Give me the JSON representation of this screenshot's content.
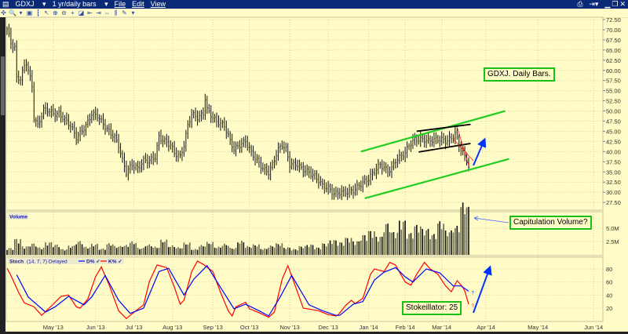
{
  "window": {
    "symbol": "GDXJ",
    "period": "1 yr/daily bars",
    "menu": [
      "File",
      "Edit",
      "View"
    ],
    "controls": [
      "minimize",
      "restore",
      "close"
    ]
  },
  "toolbar_icons": [
    "crosshair-icon",
    "zoom-icon",
    "dropdown-icon",
    "chart-type-icon",
    "bars-icon",
    "draw-line-icon",
    "zoom-in-icon",
    "zoom-out-icon",
    "cross-icon",
    "chart-icon",
    "scroll-left-icon",
    "scroll-right-icon",
    "fit-icon",
    "split-icon",
    "tools-icon",
    "dropdown-icon"
  ],
  "panels": {
    "volume_label": "Volume",
    "stoch_label": "Stoch",
    "stoch_params": "(14, 7, 7) Delayed",
    "stoch_legend": [
      {
        "label": "D%",
        "color": "#0000ff"
      },
      {
        "label": "K%",
        "color": "#ff0000"
      }
    ]
  },
  "annotations": {
    "title": "GDXJ. Daily Bars.",
    "volume": "Capitulation Volume?",
    "stoch": "Stokeillator: 25"
  },
  "colors": {
    "background": "#fffcc8",
    "bars": "#5a5a48",
    "channel": "#22cc22",
    "arrow": "#0033ff",
    "k": "#ff0000",
    "d": "#0000ff"
  },
  "chart_data": [
    {
      "type": "bar",
      "title": "GDXJ daily bars (price)",
      "x_unit": "trading day index",
      "x_labels": [
        {
          "day": 24,
          "label": "May '13"
        },
        {
          "day": 46,
          "label": "Jun '13"
        },
        {
          "day": 66,
          "label": "Jul '13"
        },
        {
          "day": 86,
          "label": "Aug '13"
        },
        {
          "day": 107,
          "label": "Sep '13"
        },
        {
          "day": 126,
          "label": "Oct '13"
        },
        {
          "day": 147,
          "label": "Nov '13"
        },
        {
          "day": 167,
          "label": "Dec '13"
        },
        {
          "day": 188,
          "label": "Jan '14"
        },
        {
          "day": 207,
          "label": "Feb '14"
        },
        {
          "day": 226,
          "label": "Mar '14"
        },
        {
          "day": 249,
          "label": "Apr '14"
        },
        {
          "day": 276,
          "label": "May '14"
        },
        {
          "day": 305,
          "label": "Jun '14"
        }
      ],
      "x_range": [
        0,
        310
      ],
      "ylim": [
        25,
        75
      ],
      "y_ticks": [
        "72.50",
        "70.00",
        "67.50",
        "65.00",
        "62.50",
        "60.00",
        "57.50",
        "55.00",
        "52.50",
        "50.00",
        "47.50",
        "45.00",
        "42.50",
        "40.00",
        "37.50",
        "35.00",
        "32.50",
        "30.00",
        "27.50"
      ],
      "closes": [
        [
          0,
          70.2
        ],
        [
          2,
          66.7
        ],
        [
          4,
          65.7
        ],
        [
          5,
          58
        ],
        [
          7,
          58
        ],
        [
          9,
          61
        ],
        [
          10,
          62
        ],
        [
          13,
          56
        ],
        [
          14,
          48.4
        ],
        [
          16,
          46.4
        ],
        [
          19,
          50.3
        ],
        [
          21,
          50.3
        ],
        [
          24,
          49.3
        ],
        [
          27,
          49.3
        ],
        [
          29,
          48.4
        ],
        [
          33,
          46.4
        ],
        [
          36,
          43.5
        ],
        [
          38,
          44.5
        ],
        [
          41,
          46.4
        ],
        [
          44,
          49.3
        ],
        [
          47,
          48.8
        ],
        [
          49,
          47.4
        ],
        [
          52,
          45.5
        ],
        [
          56,
          43.5
        ],
        [
          58,
          41.6
        ],
        [
          60,
          37.8
        ],
        [
          62,
          34.9
        ],
        [
          65,
          36.8
        ],
        [
          68,
          35.8
        ],
        [
          71,
          37.8
        ],
        [
          74,
          37.8
        ],
        [
          77,
          38.7
        ],
        [
          79,
          43.5
        ],
        [
          82,
          42.6
        ],
        [
          85,
          41.6
        ],
        [
          87,
          39.7
        ],
        [
          90,
          38.7
        ],
        [
          92,
          41.6
        ],
        [
          94,
          46.4
        ],
        [
          96,
          49.3
        ],
        [
          99,
          48.4
        ],
        [
          102,
          49.3
        ],
        [
          103,
          53.2
        ],
        [
          104,
          50.3
        ],
        [
          107,
          48.4
        ],
        [
          109,
          47.4
        ],
        [
          113,
          46.4
        ],
        [
          116,
          42.6
        ],
        [
          118,
          40.6
        ],
        [
          121,
          41.6
        ],
        [
          124,
          42.6
        ],
        [
          127,
          39.7
        ],
        [
          130,
          37.8
        ],
        [
          133,
          35.8
        ],
        [
          136,
          34.9
        ],
        [
          138,
          36.8
        ],
        [
          141,
          40.6
        ],
        [
          143,
          41.6
        ],
        [
          145,
          40.6
        ],
        [
          147,
          36.8
        ],
        [
          151,
          36.8
        ],
        [
          153,
          35.8
        ],
        [
          157,
          34.9
        ],
        [
          160,
          33.9
        ],
        [
          162,
          32.9
        ],
        [
          164,
          31.6
        ],
        [
          167,
          31
        ],
        [
          170,
          29.6
        ],
        [
          174,
          30
        ],
        [
          177,
          30
        ],
        [
          180,
          30.4
        ],
        [
          184,
          32
        ],
        [
          188,
          33.3
        ],
        [
          191,
          35.2
        ],
        [
          194,
          36.8
        ],
        [
          198,
          35.2
        ],
        [
          200,
          35.8
        ],
        [
          202,
          37.8
        ],
        [
          207,
          39.7
        ],
        [
          209,
          41.6
        ],
        [
          212,
          43
        ],
        [
          216,
          43
        ],
        [
          219,
          42.6
        ],
        [
          222,
          43
        ],
        [
          226,
          43
        ],
        [
          228,
          42.6
        ],
        [
          231,
          43.2
        ],
        [
          233,
          44.5
        ],
        [
          235,
          41.6
        ],
        [
          237,
          39.7
        ],
        [
          239,
          37.8
        ],
        [
          240,
          36.8
        ]
      ],
      "annotation_lines": {
        "upper_channel": [
          [
            184,
            40
          ],
          [
            259,
            50
          ]
        ],
        "lower_channel": [
          [
            186,
            28.5
          ],
          [
            261,
            38.2
          ]
        ],
        "flag_top": [
          [
            213,
            45
          ],
          [
            241,
            46.7
          ]
        ],
        "flag_bottom": [
          [
            214,
            39.9
          ],
          [
            241,
            42
          ]
        ]
      }
    },
    {
      "type": "bar",
      "title": "Volume",
      "y_ticks": [
        "5.0M",
        "2.5M"
      ],
      "ylim": [
        0,
        9.5
      ],
      "unit": "millions (sampled every 4 days)",
      "values": [
        1.2,
        2.8,
        1.5,
        2.0,
        1.3,
        2.2,
        1.8,
        1.0,
        1.6,
        2.4,
        1.4,
        1.9,
        1.1,
        2.0,
        1.5,
        1.7,
        2.3,
        1.2,
        1.8,
        1.4,
        2.6,
        1.6,
        1.3,
        2.1,
        1.0,
        1.7,
        2.2,
        1.4,
        1.9,
        1.2,
        2.4,
        1.5,
        1.8,
        1.1,
        1.6,
        2.0,
        1.3,
        1.0,
        1.5,
        1.8,
        1.3,
        2.0,
        2.6,
        2.2,
        3.0,
        2.4,
        3.5,
        4.2,
        3.2,
        5.5,
        4.0,
        6.0,
        3.8,
        5.2,
        4.5,
        3.6,
        5.8,
        4.2,
        5.0,
        9.0
      ]
    },
    {
      "type": "line",
      "title": "Stoch (14, 7, 7)",
      "y_ticks": [
        "80",
        "60",
        "40",
        "20"
      ],
      "ylim": [
        0,
        100
      ],
      "series": [
        {
          "name": "K%",
          "color": "#ff0000",
          "points": [
            [
              0,
              81
            ],
            [
              2,
              70
            ],
            [
              6,
              44
            ],
            [
              9,
              28
            ],
            [
              14,
              22
            ],
            [
              18,
              9
            ],
            [
              24,
              26
            ],
            [
              28,
              38
            ],
            [
              32,
              40
            ],
            [
              36,
              22
            ],
            [
              38,
              20
            ],
            [
              42,
              34
            ],
            [
              46,
              68
            ],
            [
              49,
              83
            ],
            [
              53,
              56
            ],
            [
              58,
              16
            ],
            [
              62,
              4
            ],
            [
              67,
              16
            ],
            [
              71,
              25
            ],
            [
              74,
              61
            ],
            [
              78,
              86
            ],
            [
              83,
              82
            ],
            [
              87,
              52
            ],
            [
              90,
              26
            ],
            [
              92,
              32
            ],
            [
              96,
              76
            ],
            [
              99,
              92
            ],
            [
              102,
              87
            ],
            [
              107,
              76
            ],
            [
              111,
              44
            ],
            [
              115,
              16
            ],
            [
              117,
              8
            ],
            [
              119,
              22
            ],
            [
              124,
              29
            ],
            [
              126,
              19
            ],
            [
              131,
              13
            ],
            [
              136,
              6
            ],
            [
              139,
              14
            ],
            [
              143,
              64
            ],
            [
              146,
              85
            ],
            [
              149,
              61
            ],
            [
              154,
              20
            ],
            [
              158,
              18
            ],
            [
              162,
              16
            ],
            [
              167,
              10
            ],
            [
              171,
              8
            ],
            [
              172,
              9
            ],
            [
              176,
              24
            ],
            [
              179,
              32
            ],
            [
              181,
              27
            ],
            [
              185,
              35
            ],
            [
              189,
              72
            ],
            [
              191,
              80
            ],
            [
              196,
              76
            ],
            [
              199,
              90
            ],
            [
              202,
              86
            ],
            [
              207,
              60
            ],
            [
              210,
              55
            ],
            [
              213,
              72
            ],
            [
              217,
              90
            ],
            [
              220,
              80
            ],
            [
              224,
              72
            ],
            [
              228,
              54
            ],
            [
              231,
              45
            ],
            [
              234,
              62
            ],
            [
              237,
              52
            ],
            [
              238,
              46
            ],
            [
              240,
              26
            ]
          ]
        },
        {
          "name": "D%",
          "color": "#0000ff",
          "points": [
            [
              5,
              71
            ],
            [
              11,
              37
            ],
            [
              20,
              14
            ],
            [
              25,
              22
            ],
            [
              32,
              38
            ],
            [
              40,
              25
            ],
            [
              44,
              37
            ],
            [
              51,
              70
            ],
            [
              58,
              32
            ],
            [
              64,
              12
            ],
            [
              71,
              20
            ],
            [
              79,
              76
            ],
            [
              84,
              81
            ],
            [
              92,
              40
            ],
            [
              97,
              64
            ],
            [
              104,
              85
            ],
            [
              109,
              61
            ],
            [
              118,
              19
            ],
            [
              124,
              26
            ],
            [
              131,
              16
            ],
            [
              136,
              8
            ],
            [
              142,
              37
            ],
            [
              148,
              70
            ],
            [
              157,
              25
            ],
            [
              164,
              16
            ],
            [
              171,
              9
            ],
            [
              173,
              9
            ],
            [
              180,
              26
            ],
            [
              185,
              30
            ],
            [
              191,
              63
            ],
            [
              196,
              75
            ],
            [
              202,
              82
            ],
            [
              207,
              68
            ],
            [
              211,
              60
            ],
            [
              218,
              80
            ],
            [
              225,
              74
            ],
            [
              232,
              54
            ],
            [
              236,
              54
            ],
            [
              240,
              46
            ]
          ]
        }
      ]
    }
  ]
}
